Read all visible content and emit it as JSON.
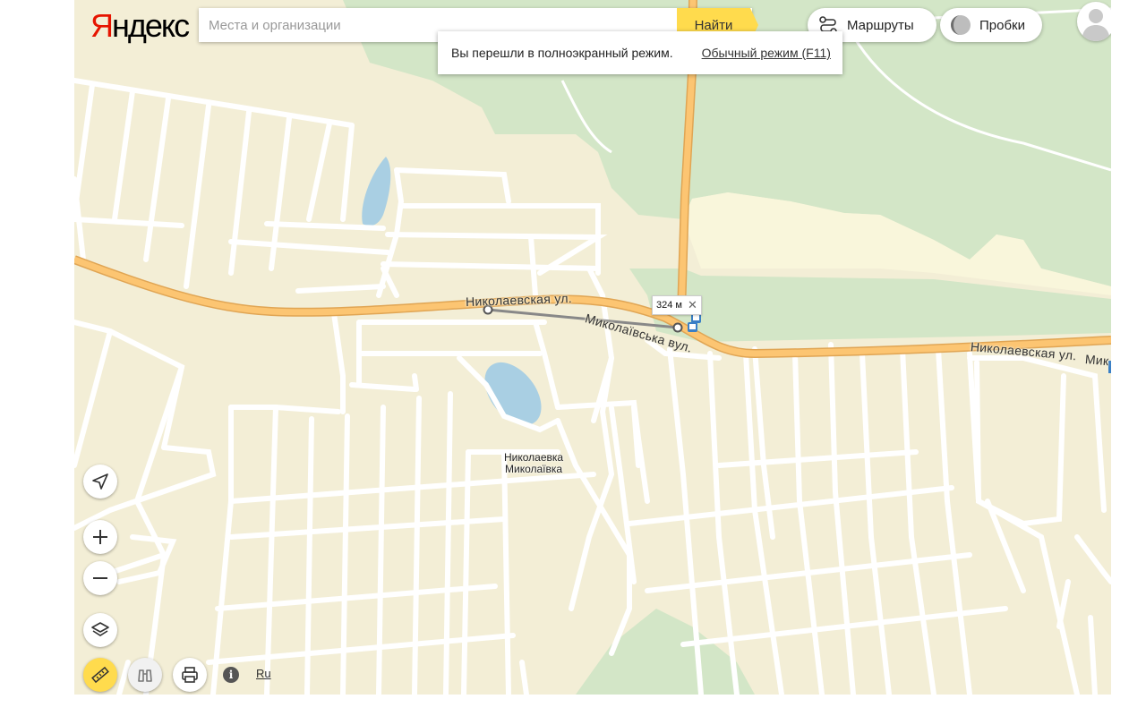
{
  "brand": {
    "logo_first": "Я",
    "logo_rest": "ндекс"
  },
  "search": {
    "placeholder": "Места и организации",
    "button_label": "Найти"
  },
  "toolbar": {
    "routes_label": "Маршруты",
    "traffic_label": "Пробки"
  },
  "notice": {
    "message": "Вы перешли в полноэкранный режим.",
    "link_label": "Обычный режим (F11)"
  },
  "map": {
    "streets": {
      "main_ru_west": "Николаевская ул.",
      "main_ua": "Миколаївська вул.",
      "main_ru_east": "Николаевская ул.",
      "main_ua_east_cut": "Мик"
    },
    "place": {
      "name_ru": "Николаевка",
      "name_ua": "Миколаївка"
    },
    "measurement": {
      "distance": "324 м",
      "close_glyph": "✕"
    }
  },
  "footer": {
    "info_glyph": "i",
    "language": "Ru"
  },
  "colors": {
    "land": "#f3eed6",
    "forest": "#d3e6c7",
    "main_road": "#fcc572",
    "main_road_edge": "#e0a554",
    "water": "#a9cfe3",
    "accent_yellow": "#ffdb4d"
  },
  "icons": [
    "locate-icon",
    "zoom-in-icon",
    "zoom-out-icon",
    "layers-icon",
    "ruler-icon",
    "binoculars-icon",
    "print-icon",
    "info-icon",
    "routes-icon",
    "traffic-icon",
    "user-icon",
    "bus-stop-icon"
  ]
}
